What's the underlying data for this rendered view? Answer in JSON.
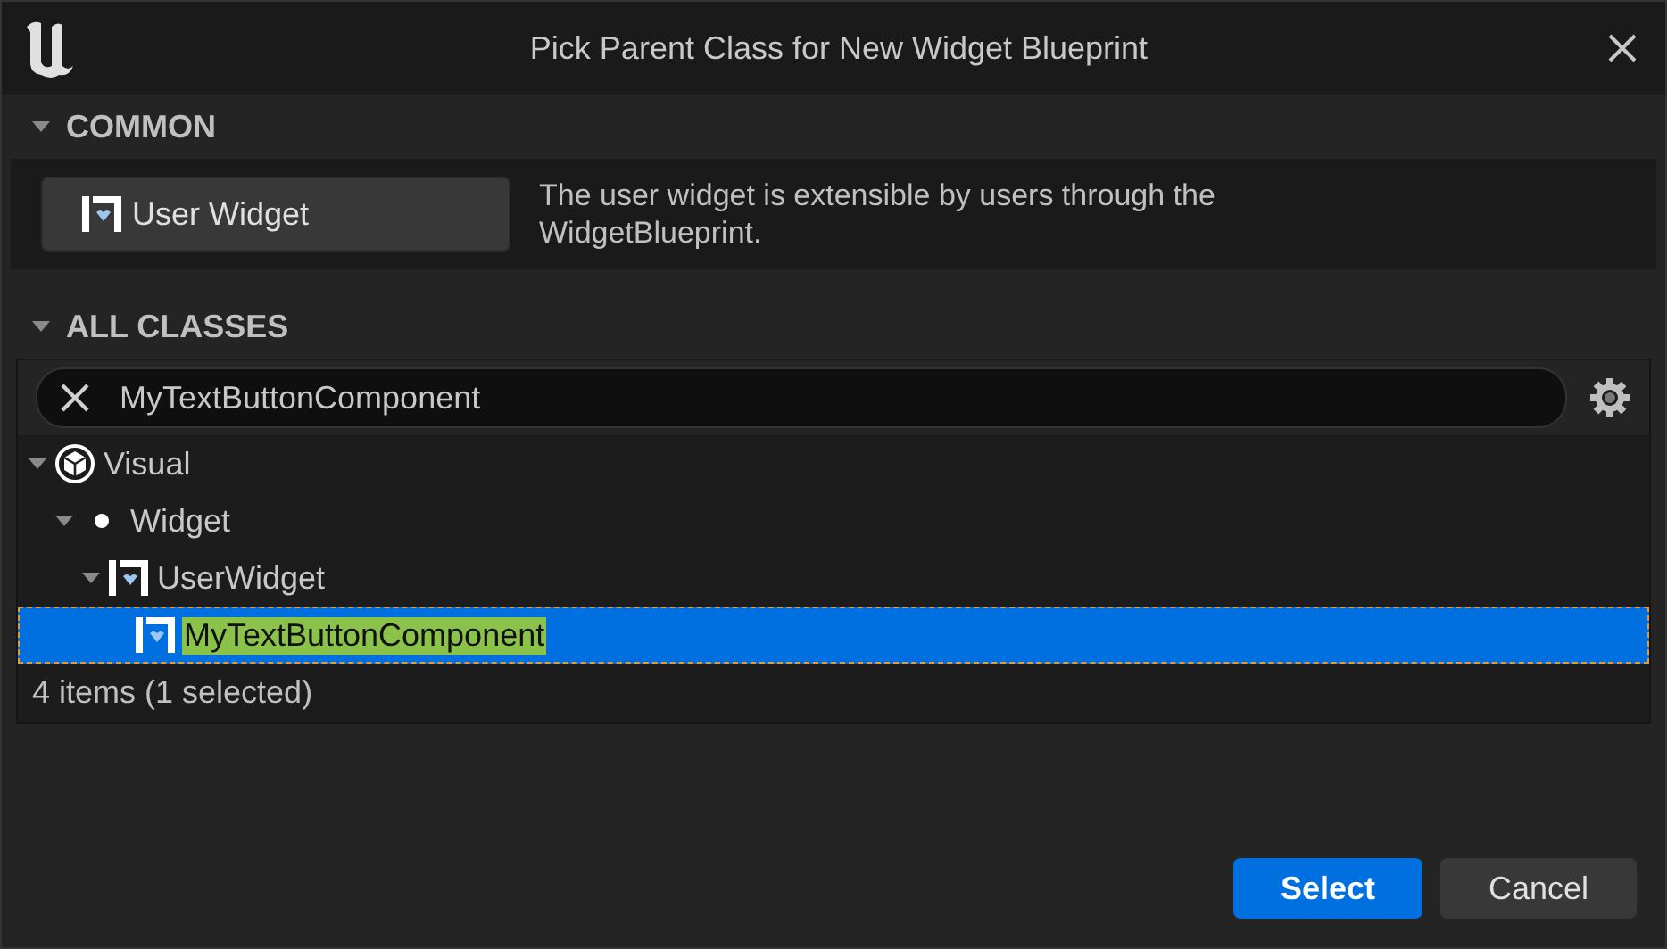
{
  "window": {
    "title": "Pick Parent Class for New Widget Blueprint"
  },
  "common": {
    "title": "COMMON",
    "expanded": true,
    "items": [
      {
        "label": "User Widget",
        "description": "The user widget is extensible by users through the WidgetBlueprint."
      }
    ]
  },
  "all_classes": {
    "title": "ALL CLASSES",
    "expanded": true,
    "search": {
      "value": "MyTextButtonComponent"
    },
    "tree": [
      {
        "label": "Visual",
        "kind": "category",
        "expanded": true,
        "selected": false,
        "highlighted": false,
        "children": [
          {
            "label": "Widget",
            "kind": "dot",
            "expanded": true,
            "selected": false,
            "highlighted": false,
            "children": [
              {
                "label": "UserWidget",
                "kind": "userwidget",
                "expanded": true,
                "selected": false,
                "highlighted": false,
                "children": [
                  {
                    "label": "MyTextButtonComponent",
                    "kind": "userwidget",
                    "selected": true,
                    "highlighted": true
                  }
                ]
              }
            ]
          }
        ]
      }
    ],
    "status": "4 items (1 selected)"
  },
  "buttons": [
    {
      "label": "Select",
      "primary": true
    },
    {
      "label": "Cancel",
      "primary": false
    }
  ]
}
